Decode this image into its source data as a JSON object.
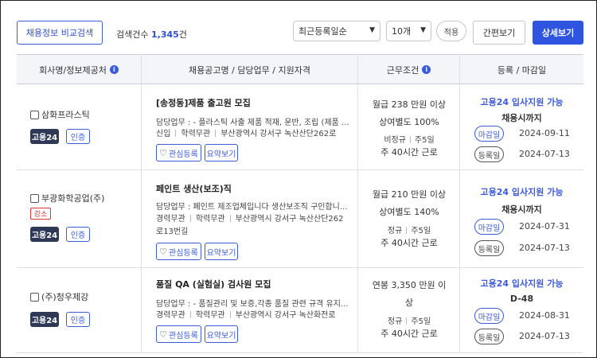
{
  "toolbar": {
    "compare_button": "채용정보 비교검색",
    "count_label": "검색건수",
    "count_value": "1,345",
    "count_unit": "건",
    "sort_select": "최근등록일순",
    "per_page_select": "10개",
    "apply_button": "적용",
    "simple_view_button": "간편보기",
    "detail_view_button": "상세보기"
  },
  "table": {
    "headers": [
      "회사명/정보제공처",
      "채용공고명 / 담당업무 / 지원자격",
      "근무조건",
      "등록 / 마감일"
    ],
    "fav_label": "관심등록",
    "summary_label": "요약보기",
    "rows": [
      {
        "company": "삼화프라스틱",
        "small_badge": "",
        "source_badge": "고용24",
        "cert_badge": "인증",
        "title": "[송정동]제품 출고원 모집",
        "task": "담당업무 : - 플라스틱 사출 제품 적재, 운반, 조립 (제품 ...",
        "career": "신입",
        "education": "학력무관",
        "location_line1": "부산광역시 강서구 녹산산단262로",
        "location_line2": "",
        "pay": "월급 238 만원 이상",
        "bonus": "상여별도 100%",
        "employment_type": "비정규",
        "days": "주5일",
        "hours": "주 40시간 근로",
        "support": "고용24 입사지원 가능",
        "deadline_text": "채용시까지",
        "deadline_label": "마감일",
        "deadline_date": "2024-09-11",
        "reg_label": "등록일",
        "reg_date": "2024-07-13"
      },
      {
        "company": "부광화학공업(주)",
        "small_badge": "강소",
        "source_badge": "고용24",
        "cert_badge": "인증",
        "title": "페인트 생산(보조)직",
        "task": "담당업무 : 페인트 제조업체입니다 생산보조직 구인합니...",
        "career": "경력무관",
        "education": "학력무관",
        "location_line1": "부산광역시 강서구 녹산산단262",
        "location_line2": "로13번길",
        "pay": "월급 210 만원 이상",
        "bonus": "상여별도 140%",
        "employment_type": "정규",
        "days": "주5일",
        "hours": "주 40시간 근로",
        "support": "고용24 입사지원 가능",
        "deadline_text": "채용시까지",
        "deadline_label": "마감일",
        "deadline_date": "2024-07-31",
        "reg_label": "등록일",
        "reg_date": "2024-07-13"
      },
      {
        "company": "(주)청우제강",
        "small_badge": "",
        "source_badge": "고용24",
        "cert_badge": "인증",
        "title": "품질 QA (실험실) 검사원 모집",
        "task": "담당업무 : - 품질관리 및 보증,각종 품질 관련 규격 유지...",
        "career": "경력무관",
        "education": "학력무관",
        "location_line1": "부산광역시 강서구 녹산화전로",
        "location_line2": "",
        "pay_line1": "연봉 3,350 만원 이",
        "pay_line2": "상",
        "employment_type": "정규",
        "days": "주5일",
        "hours": "주 40시간 근로",
        "support": "고용24 입사지원 가능",
        "deadline_text": "D-48",
        "deadline_label": "마감일",
        "deadline_date": "2024-08-31",
        "reg_label": "등록일",
        "reg_date": "2024-07-13"
      }
    ]
  },
  "colors": {
    "accent": "#2f55e0",
    "badge_dark": "#2e3a55",
    "badge_red": "#e03131",
    "header_bg": "#f3f5f8"
  },
  "icons": [
    "info-icon",
    "heart-icon",
    "chevron-down-icon",
    "checkbox"
  ]
}
